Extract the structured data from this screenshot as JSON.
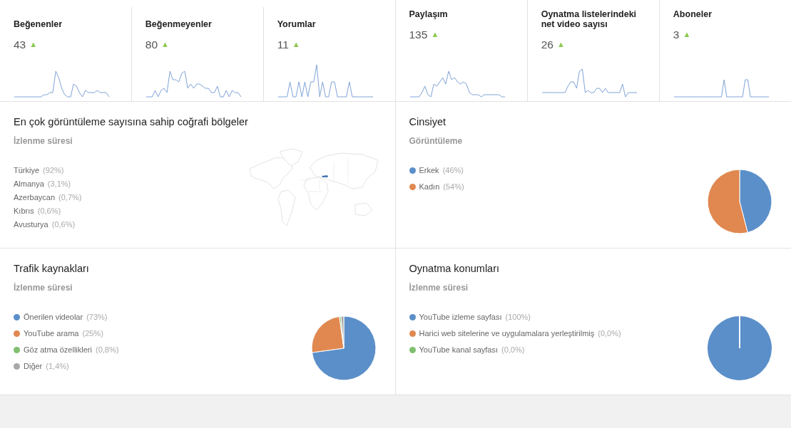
{
  "metrics": [
    {
      "title": "Beğenenler",
      "value": "43",
      "trend": "▲"
    },
    {
      "title": "Beğenmeyenler",
      "value": "80",
      "trend": "▲"
    },
    {
      "title": "Yorumlar",
      "value": "11",
      "trend": "▲"
    },
    {
      "title": "Paylaşım",
      "value": "135",
      "trend": "▲"
    },
    {
      "title": "Oynatma listelerindeki net video sayısı",
      "value": "26",
      "trend": "▲"
    },
    {
      "title": "Aboneler",
      "value": "3",
      "trend": "▲"
    }
  ],
  "geography": {
    "title": "En çok görüntüleme sayısına sahip coğrafi bölgeler",
    "subtitle": "İzlenme süresi",
    "items": [
      {
        "label": "Türkiye",
        "share": "(92%)"
      },
      {
        "label": "Almanya",
        "share": "(3,1%)"
      },
      {
        "label": "Azerbaycan",
        "share": "(0,7%)"
      },
      {
        "label": "Kıbrıs",
        "share": "(0,6%)"
      },
      {
        "label": "Avusturya",
        "share": "(0,6%)"
      }
    ]
  },
  "gender": {
    "title": "Cinsiyet",
    "subtitle": "Görüntüleme",
    "legend": [
      {
        "label": "Erkek",
        "share": "(46%)",
        "color": "#5b8fc9"
      },
      {
        "label": "Kadın",
        "share": "(54%)",
        "color": "#e08850"
      }
    ],
    "chart_data": {
      "type": "pie",
      "values": [
        46,
        54
      ]
    }
  },
  "traffic": {
    "title": "Trafik kaynakları",
    "subtitle": "İzlenme süresi",
    "legend": [
      {
        "label": "Önerilen videolar",
        "share": "(73%)",
        "color": "#5b8fc9"
      },
      {
        "label": "YouTube arama",
        "share": "(25%)",
        "color": "#e08850"
      },
      {
        "label": "Göz atma özellikleri",
        "share": "(0,8%)",
        "color": "#7fbf6f"
      },
      {
        "label": "Diğer",
        "share": "(1,4%)",
        "color": "#a8a8a8"
      }
    ],
    "chart_data": {
      "type": "pie",
      "values": [
        73,
        25,
        0.8,
        1.4
      ]
    }
  },
  "playback": {
    "title": "Oynatma konumları",
    "subtitle": "İzlenme süresi",
    "legend": [
      {
        "label": "YouTube izleme sayfası",
        "share": "(100%)",
        "color": "#5b8fc9"
      },
      {
        "label": "Harici web sitelerine ve uygulamalara yerleştirilmiş",
        "share": "(0,0%)",
        "color": "#e08850"
      },
      {
        "label": "YouTube kanal sayfası",
        "share": "(0,0%)",
        "color": "#7fbf6f"
      }
    ],
    "chart_data": {
      "type": "pie",
      "values": [
        100,
        0,
        0
      ]
    }
  }
}
